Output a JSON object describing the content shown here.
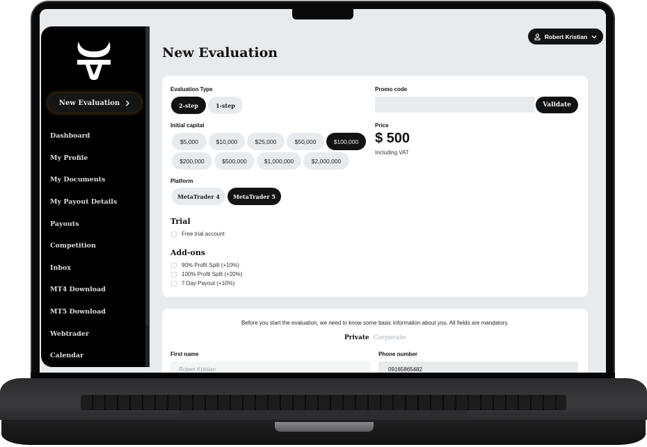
{
  "app": {
    "brand_icon": "bull-head-logo-icon"
  },
  "sidebar": {
    "cta": {
      "label": "New Evaluation",
      "icon": "chevron-right-icon"
    },
    "items": [
      {
        "label": "Dashboard"
      },
      {
        "label": "My Profile"
      },
      {
        "label": "My Documents"
      },
      {
        "label": "My Payout Details"
      },
      {
        "label": "Payouts"
      },
      {
        "label": "Competition"
      },
      {
        "label": "Inbox"
      },
      {
        "label": "MT4 Download"
      },
      {
        "label": "MT5 Download"
      },
      {
        "label": "Webtrader"
      },
      {
        "label": "Calendar"
      }
    ]
  },
  "header": {
    "user": {
      "name": "Robert Kristian",
      "icon": "user-icon",
      "dropdown_icon": "chevron-down-icon"
    }
  },
  "page": {
    "title": "New Evaluation"
  },
  "evaluation": {
    "type_label": "Evaluation Type",
    "types": [
      {
        "label": "2-step",
        "selected": true
      },
      {
        "label": "1-step",
        "selected": false
      }
    ],
    "capital_label": "Initial capital",
    "capitals": [
      {
        "label": "$5,000",
        "selected": false
      },
      {
        "label": "$10,000",
        "selected": false
      },
      {
        "label": "$25,000",
        "selected": false
      },
      {
        "label": "$50,000",
        "selected": false
      },
      {
        "label": "$100,000",
        "selected": true
      },
      {
        "label": "$200,000",
        "selected": false
      },
      {
        "label": "$500,000",
        "selected": false
      },
      {
        "label": "$1,000,000",
        "selected": false
      },
      {
        "label": "$2,000,000",
        "selected": false
      }
    ],
    "platform_label": "Platform",
    "platforms": [
      {
        "label": "MetaTrader 4",
        "selected": false
      },
      {
        "label": "MetaTrader 5",
        "selected": true
      }
    ],
    "trial": {
      "heading": "Trial",
      "options": [
        {
          "label": "Free trial account",
          "checked": false
        }
      ]
    },
    "addons": {
      "heading": "Add-ons",
      "options": [
        {
          "label": "90% Profit Split (+10%)",
          "checked": false
        },
        {
          "label": "100% Profit Split (+20%)",
          "checked": false
        },
        {
          "label": "7 Day Payout (+10%)",
          "checked": false
        }
      ]
    },
    "promo": {
      "label": "Promo code",
      "value": "",
      "placeholder": "",
      "button": "Validate"
    },
    "price": {
      "label": "Price",
      "value": "$ 500",
      "note": "Including VAT"
    }
  },
  "personal": {
    "info": "Before you start the evaluation, we need to know some basic information about you. All fields are mandatory.",
    "tabs": [
      {
        "label": "Private",
        "active": true
      },
      {
        "label": "Corporate",
        "active": false
      }
    ],
    "first_name": {
      "label": "First name",
      "placeholder": "Robert Kristian",
      "value": ""
    },
    "phone": {
      "label": "Phone number",
      "value": "09165865482"
    }
  }
}
